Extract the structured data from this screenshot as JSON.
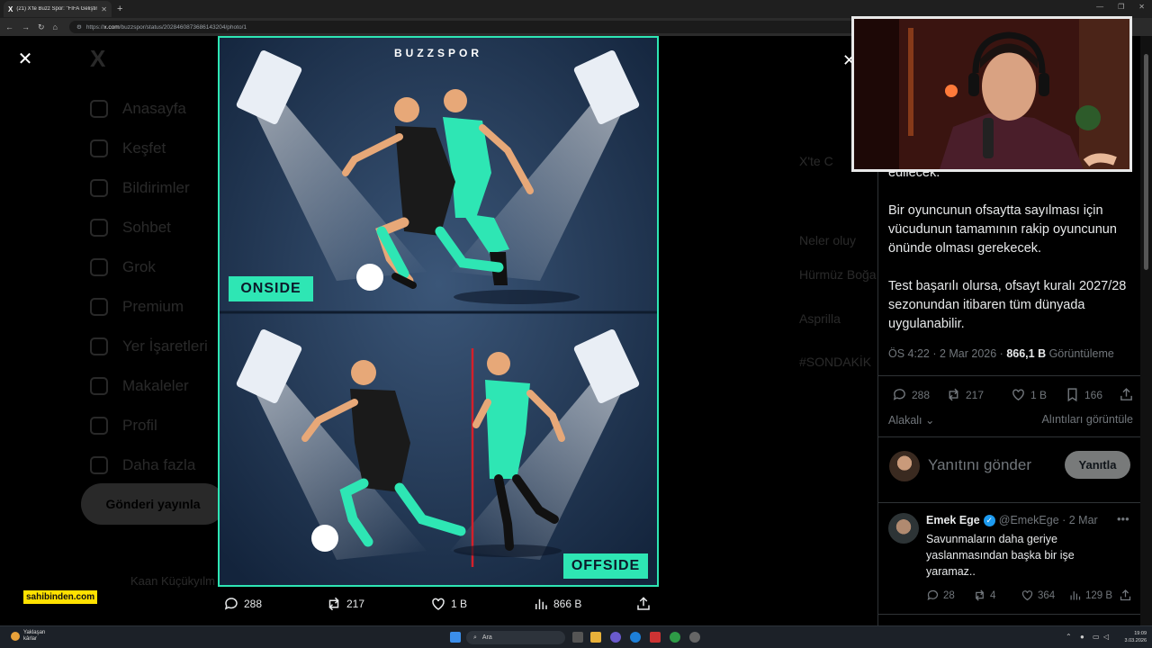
{
  "browser": {
    "tab_title": "(21) X'te Buzz Spor: \"FIFA Geliştirm...",
    "url_prefix": "https://",
    "url_domain": "x.com",
    "url_path": "/buzzspor/status/2028460873686143204/photo/1"
  },
  "background_page": {
    "nav_items": [
      "Anasayfa",
      "Keşfet",
      "Bildirimler",
      "Sohbet",
      "Grok",
      "Premium",
      "Yer İşaretleri",
      "Makaleler",
      "Profil",
      "Daha fazla"
    ],
    "post_button": "Gönderi yayınla",
    "right_lines": [
      "X'te C",
      "Neler oluy",
      "Hürmüz Boğa",
      "Asprilla",
      "#SONDAKİK"
    ],
    "bottom_user": "Kaan Küçükyılm"
  },
  "photo": {
    "brand": "BUZZSPOR",
    "label_onside": "ONSIDE",
    "label_offside": "OFFSIDE"
  },
  "viewer_actions": {
    "replies": "288",
    "reposts": "217",
    "likes": "1 B",
    "views": "866 B"
  },
  "ad_label": "sahibinden.com",
  "tweet": {
    "text_top": "edilecek.",
    "para1": "Bir oyuncunun ofsaytta sayılması için vücudunun tamamının rakip oyuncunun önünde olması gerekecek.",
    "para2": "Test başarılı olursa, ofsayt kuralı 2027/28 sezonundan itibaren tüm dünyada uygulanabilir.",
    "time": "ÖS 4:22 · 2 Mar 2026 · ",
    "views_count": "866,1 B",
    "views_label": " Görüntüleme",
    "stats": {
      "replies": "288",
      "reposts": "217",
      "likes": "1 B",
      "bookmarks": "166"
    },
    "sort_label": "Alakalı",
    "quotes_link": "Alıntıları görüntüle",
    "reply_placeholder": "Yanıtını gönder",
    "reply_button": "Yanıtla"
  },
  "comment": {
    "name": "Emek Ege",
    "handle": "@EmekEge · 2 Mar",
    "text": "Savunmaların daha geriye yaslanmasından başka bir işe yaramaz..",
    "stats": {
      "replies": "28",
      "reposts": "4",
      "likes": "364",
      "views": "129 B"
    }
  },
  "taskbar": {
    "weather_title": "Yaklaşan",
    "weather_sub": "kârlar",
    "search": "Ara",
    "time": "19:09",
    "date": "3.03.2026"
  },
  "colors": {
    "accent": "#2ee6b4",
    "x_blue": "#1d9bf0",
    "offside_line": "#d4202a"
  }
}
